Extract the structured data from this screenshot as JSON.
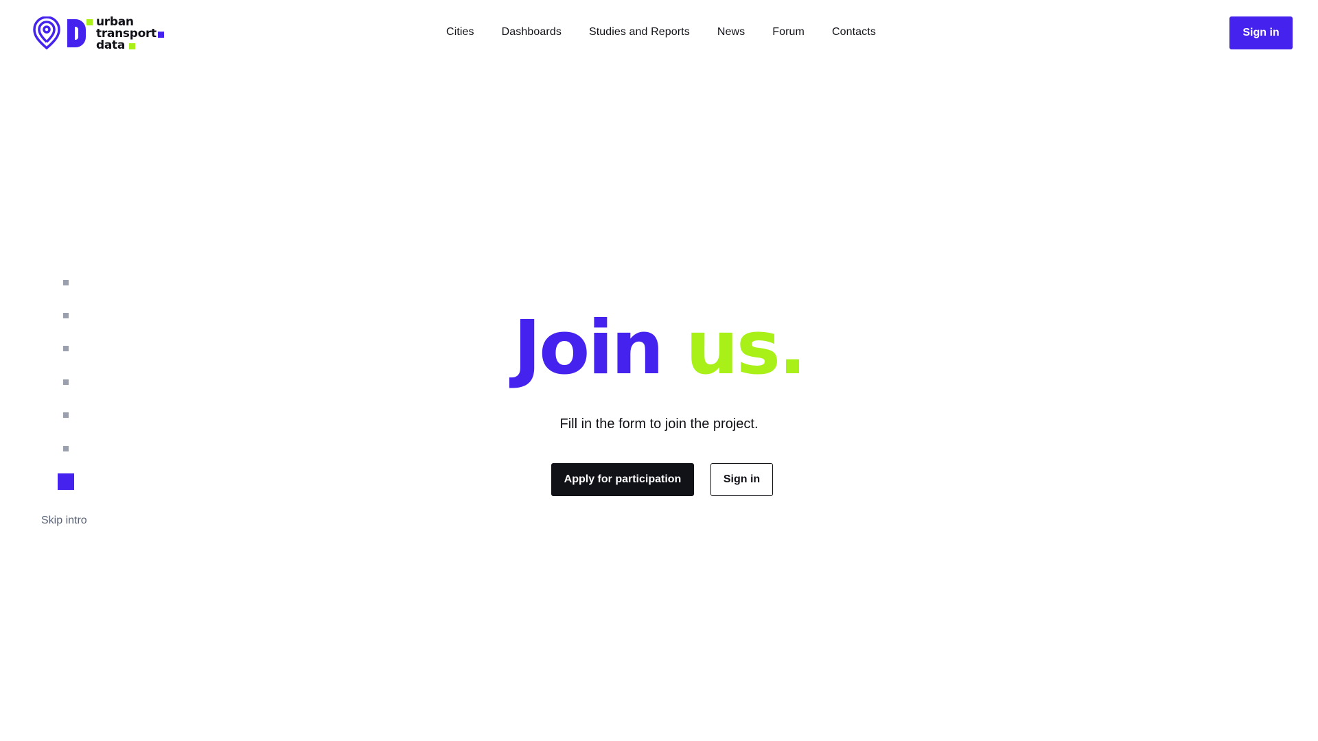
{
  "brand": {
    "logo_lines": [
      "urban",
      "transport",
      "data"
    ],
    "primary_color": "#4522ee",
    "accent_color": "#a8f018",
    "logo_icon": "location-pin-icon"
  },
  "nav": {
    "items": [
      {
        "label": "Cities"
      },
      {
        "label": "Dashboards"
      },
      {
        "label": "Studies and Reports"
      },
      {
        "label": "News"
      },
      {
        "label": "Forum"
      },
      {
        "label": "Contacts"
      }
    ]
  },
  "header": {
    "sign_in_label": "Sign in"
  },
  "intro": {
    "step_count": 7,
    "current_step": 7,
    "skip_label": "Skip intro"
  },
  "hero": {
    "title_part1": "Join",
    "title_part2": "us.",
    "subtitle": "Fill in the form to join the project.",
    "apply_label": "Apply for participation",
    "sign_in_label": "Sign in"
  }
}
